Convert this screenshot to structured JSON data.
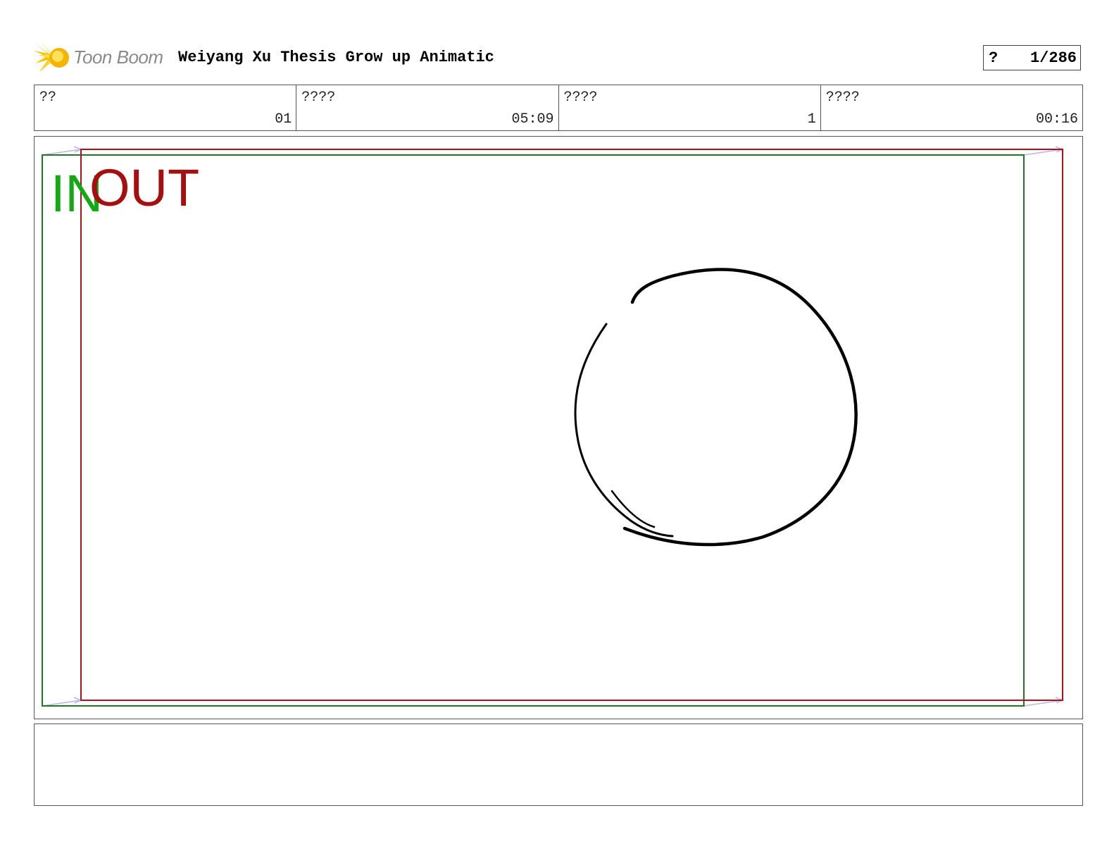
{
  "header": {
    "logo_text": "Toon Boom",
    "project_title": "Weiyang Xu Thesis Grow up Animatic",
    "page_label": "?",
    "page_number": "1/286"
  },
  "info": [
    {
      "label": "??",
      "value": "01"
    },
    {
      "label": "????",
      "value": "05:09"
    },
    {
      "label": "????",
      "value": "1"
    },
    {
      "label": "????",
      "value": "00:16"
    }
  ],
  "panel": {
    "in_label": "IN",
    "out_label": "OUT",
    "in_frame_color": "#1e7a1e",
    "out_frame_color": "#b0101a",
    "camera_arrow_color": "#b6b6e8"
  },
  "notes": {
    "text": ""
  }
}
